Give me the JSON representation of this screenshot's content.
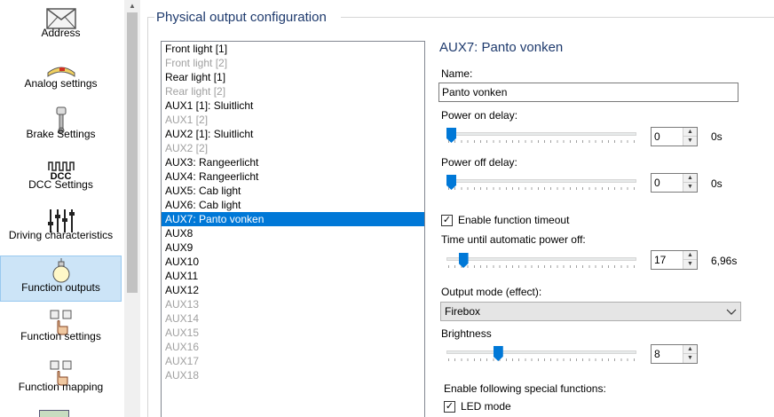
{
  "sidebar": {
    "items": [
      {
        "label": "Address",
        "icon": "envelope-icon"
      },
      {
        "label": "Analog settings",
        "icon": "analog-icon"
      },
      {
        "label": "Brake Settings",
        "icon": "brake-icon"
      },
      {
        "label": "DCC Settings",
        "icon": "dcc-icon",
        "icon_text": "DCC"
      },
      {
        "label": "Driving characteristics",
        "icon": "sliders-icon"
      },
      {
        "label": "Function outputs",
        "icon": "lightbulb-icon",
        "active": true
      },
      {
        "label": "Function settings",
        "icon": "function-hand-icon"
      },
      {
        "label": "Function mapping",
        "icon": "function-mapping-icon"
      }
    ]
  },
  "group": {
    "title": "Physical output configuration"
  },
  "outputs": [
    {
      "label": "Front light [1]",
      "enabled": true
    },
    {
      "label": "Front light [2]",
      "enabled": false
    },
    {
      "label": "Rear light [1]",
      "enabled": true
    },
    {
      "label": "Rear light [2]",
      "enabled": false
    },
    {
      "label": "AUX1 [1]: Sluitlicht",
      "enabled": true
    },
    {
      "label": "AUX1 [2]",
      "enabled": false
    },
    {
      "label": "AUX2 [1]: Sluitlicht",
      "enabled": true
    },
    {
      "label": "AUX2 [2]",
      "enabled": false
    },
    {
      "label": "AUX3: Rangeerlicht",
      "enabled": true
    },
    {
      "label": "AUX4: Rangeerlicht",
      "enabled": true
    },
    {
      "label": "AUX5: Cab light",
      "enabled": true
    },
    {
      "label": "AUX6: Cab light",
      "enabled": true
    },
    {
      "label": "AUX7: Panto vonken",
      "enabled": true,
      "selected": true
    },
    {
      "label": "AUX8",
      "enabled": true
    },
    {
      "label": "AUX9",
      "enabled": true
    },
    {
      "label": "AUX10",
      "enabled": true
    },
    {
      "label": "AUX11",
      "enabled": true
    },
    {
      "label": "AUX12",
      "enabled": true
    },
    {
      "label": "AUX13",
      "enabled": false
    },
    {
      "label": "AUX14",
      "enabled": false
    },
    {
      "label": "AUX15",
      "enabled": false
    },
    {
      "label": "AUX16",
      "enabled": false
    },
    {
      "label": "AUX17",
      "enabled": false
    },
    {
      "label": "AUX18",
      "enabled": false
    }
  ],
  "details": {
    "title": "AUX7: Panto vonken",
    "name_label": "Name:",
    "name_value": "Panto vonken",
    "power_on": {
      "label": "Power on delay:",
      "value": "0",
      "unit": "0s",
      "slider_fraction": 0
    },
    "power_off": {
      "label": "Power off delay:",
      "value": "0",
      "unit": "0s",
      "slider_fraction": 0
    },
    "timeout_checkbox": {
      "label": "Enable function timeout",
      "checked": true
    },
    "timeout": {
      "label": "Time until automatic power off:",
      "value": "17",
      "unit": "6,96s",
      "slider_fraction": 0.067
    },
    "mode": {
      "label": "Output mode (effect):",
      "value": "Firebox"
    },
    "brightness": {
      "label": "Brightness",
      "value": "8",
      "slider_fraction": 0.26
    },
    "special_label": "Enable following special functions:",
    "led_mode": {
      "label": "LED mode",
      "checked": true
    }
  },
  "colors": {
    "accent": "#0078d7",
    "heading": "#1e3a6d",
    "selection_bg": "#cce4f7"
  }
}
